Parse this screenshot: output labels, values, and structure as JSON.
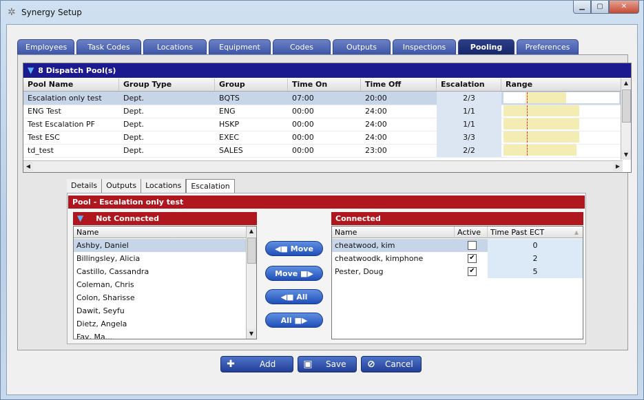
{
  "window": {
    "title": "Synergy Setup"
  },
  "tabs": [
    "Employees",
    "Task Codes",
    "Locations",
    "Equipment",
    "Codes",
    "Outputs",
    "Inspections",
    "Pooling",
    "Preferences"
  ],
  "active_tab": "Pooling",
  "pools": {
    "header": "8 Dispatch Pool(s)",
    "columns": [
      "Pool Name",
      "Group Type",
      "Group",
      "Time On",
      "Time Off",
      "Escalation",
      "Range"
    ],
    "rows": [
      {
        "name": "Escalation only test",
        "group_type": "Dept.",
        "group": "BQTS",
        "time_on": "07:00",
        "time_off": "20:00",
        "escalation": "2/3",
        "range_on": 0.29,
        "range_off": 0.83
      },
      {
        "name": "ENG Test",
        "group_type": "Dept.",
        "group": "ENG",
        "time_on": "00:00",
        "time_off": "24:00",
        "escalation": "1/1",
        "range_on": 0,
        "range_off": 1
      },
      {
        "name": "Test Escalation PF",
        "group_type": "Dept.",
        "group": "HSKP",
        "time_on": "00:00",
        "time_off": "24:00",
        "escalation": "1/1",
        "range_on": 0,
        "range_off": 1
      },
      {
        "name": "Test ESC",
        "group_type": "Dept.",
        "group": "EXEC",
        "time_on": "00:00",
        "time_off": "24:00",
        "escalation": "3/3",
        "range_on": 0,
        "range_off": 1
      },
      {
        "name": "td_test",
        "group_type": "Dept.",
        "group": "SALES",
        "time_on": "00:00",
        "time_off": "23:00",
        "escalation": "2/2",
        "range_on": 0,
        "range_off": 0.96
      }
    ]
  },
  "subtabs": [
    "Details",
    "Outputs",
    "Locations",
    "Escalation"
  ],
  "active_subtab": "Escalation",
  "pool_title": "Pool - Escalation only test",
  "not_connected": {
    "title": "Not Connected",
    "column": "Name",
    "items": [
      "Ashby, Daniel",
      "Billingsley, Alicia",
      "Castillo, Cassandra",
      "Coleman, Chris",
      "Colon, Sharisse",
      "Dawit, Seyfu",
      "Dietz, Angela",
      "Fay, Ma..."
    ]
  },
  "move_buttons": {
    "move_left": "Move",
    "move_right": "Move",
    "all_left": "All",
    "all_right": "All"
  },
  "connected": {
    "title": "Connected",
    "columns": [
      "Name",
      "Active",
      "Time Past ECT"
    ],
    "rows": [
      {
        "name": "cheatwood, kim",
        "active": false,
        "time": "0"
      },
      {
        "name": "cheatwoodk, kimphone",
        "active": true,
        "time": "2"
      },
      {
        "name": "Pester, Doug",
        "active": true,
        "time": "5"
      }
    ]
  },
  "buttons": {
    "add": "Add",
    "save": "Save",
    "cancel": "Cancel"
  }
}
